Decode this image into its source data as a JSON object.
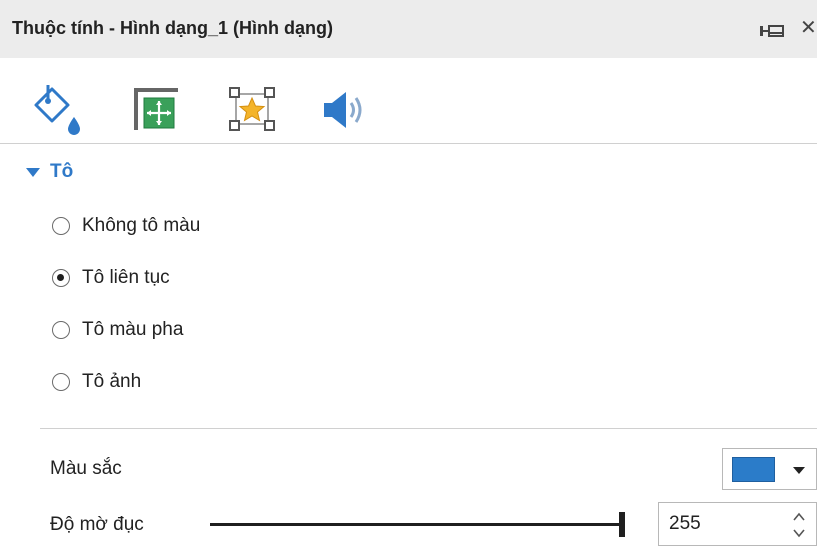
{
  "window": {
    "title": "Thuộc tính - Hình dạng_1 (Hình dạng)",
    "close_label": "✕"
  },
  "tabs": [
    {
      "name": "fill",
      "icon": "paint-bucket-icon",
      "active": true
    },
    {
      "name": "size-position",
      "icon": "resize-icon",
      "active": false
    },
    {
      "name": "effect",
      "icon": "star-frame-icon",
      "active": false
    },
    {
      "name": "sound",
      "icon": "speaker-icon",
      "active": false
    }
  ],
  "fill_section": {
    "label": "Tô",
    "expanded": true,
    "options": [
      {
        "label": "Không tô màu",
        "checked": false
      },
      {
        "label": "Tô liên tục",
        "checked": true
      },
      {
        "label": "Tô màu pha",
        "checked": false
      },
      {
        "label": "Tô ảnh",
        "checked": false
      }
    ]
  },
  "color": {
    "label": "Màu sắc",
    "value": "#2b7cc9"
  },
  "opacity": {
    "label": "Độ mờ đục",
    "value": "255",
    "min": 0,
    "max": 255
  },
  "colors": {
    "accent": "#2f79c8",
    "titlebar": "#ececec"
  }
}
